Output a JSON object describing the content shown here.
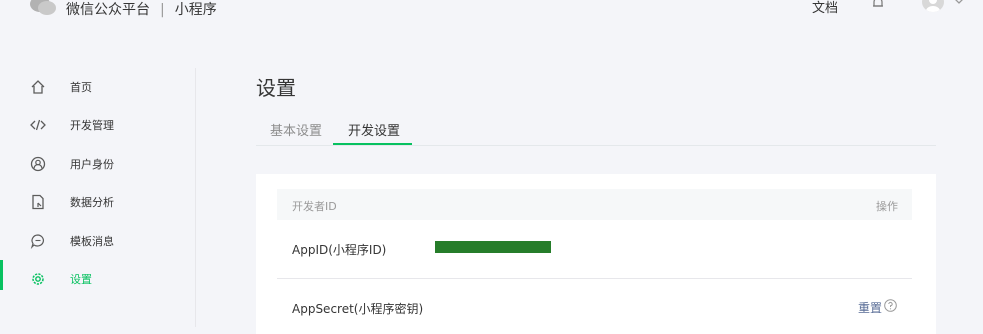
{
  "header": {
    "brand_name": "微信公众平台",
    "separator": "|",
    "product": "小程序",
    "docs_link": "文档"
  },
  "sidebar": {
    "items": [
      {
        "label": "首页",
        "icon": "home-icon"
      },
      {
        "label": "开发管理",
        "icon": "code-icon"
      },
      {
        "label": "用户身份",
        "icon": "user-icon"
      },
      {
        "label": "数据分析",
        "icon": "data-analysis-icon"
      },
      {
        "label": "模板消息",
        "icon": "message-icon"
      },
      {
        "label": "设置",
        "icon": "gear-icon",
        "active": true
      }
    ]
  },
  "main": {
    "title": "设置",
    "tabs": [
      {
        "label": "基本设置",
        "active": false
      },
      {
        "label": "开发设置",
        "active": true
      }
    ],
    "table": {
      "header_left": "开发者ID",
      "header_right": "操作",
      "rows": [
        {
          "key": "AppID(小程序ID)",
          "value_redacted": true
        },
        {
          "key": "AppSecret(小程序密钥)",
          "action": "重置"
        }
      ]
    }
  },
  "colors": {
    "accent": "#07c160",
    "link": "#576b95",
    "redaction": "#267d2a"
  }
}
